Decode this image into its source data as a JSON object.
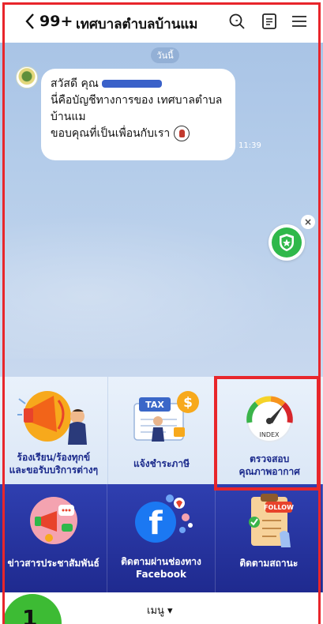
{
  "header": {
    "back_icon": "chevron-left-icon",
    "unread_count": "99+",
    "title": "เทศบาลตำบลบ้านแม",
    "icons": [
      "search-icon",
      "note-icon",
      "hamburger-menu-icon"
    ]
  },
  "chat": {
    "date_chip": "วันนี้",
    "message_lines": [
      "สวัสดี คุณ",
      "นี่คือบัญชีทางการของ เทศบาลตำบล",
      "บ้านแม",
      "ขอบคุณที่เป็นเพื่อนกับเรา"
    ],
    "time": "11:39",
    "shield_close": "×"
  },
  "rich_menu": {
    "top": [
      {
        "label_1": "ร้องเรียน/ร้องทุกข์",
        "label_2": "และขอรับบริการต่างๆ"
      },
      {
        "label_1": "แจ้งชำระภาษี",
        "label_2": "",
        "tax_text": "TAX"
      },
      {
        "label_1": "ตรวจสอบ",
        "label_2": "คุณภาพอากาศ",
        "gauge_text": "INDEX"
      }
    ],
    "bottom": [
      {
        "label_1": "ข่าวสารประชาสัมพันธ์",
        "label_2": ""
      },
      {
        "label_1": "ติดตามผ่านช่องทาง",
        "label_2": "Facebook"
      },
      {
        "label_1": "ติดตามสถานะ",
        "label_2": "",
        "follow_text": "FOLLOW"
      }
    ]
  },
  "bottom_bar": {
    "menu_label": "เมนู ▾"
  },
  "step_badge": "1"
}
